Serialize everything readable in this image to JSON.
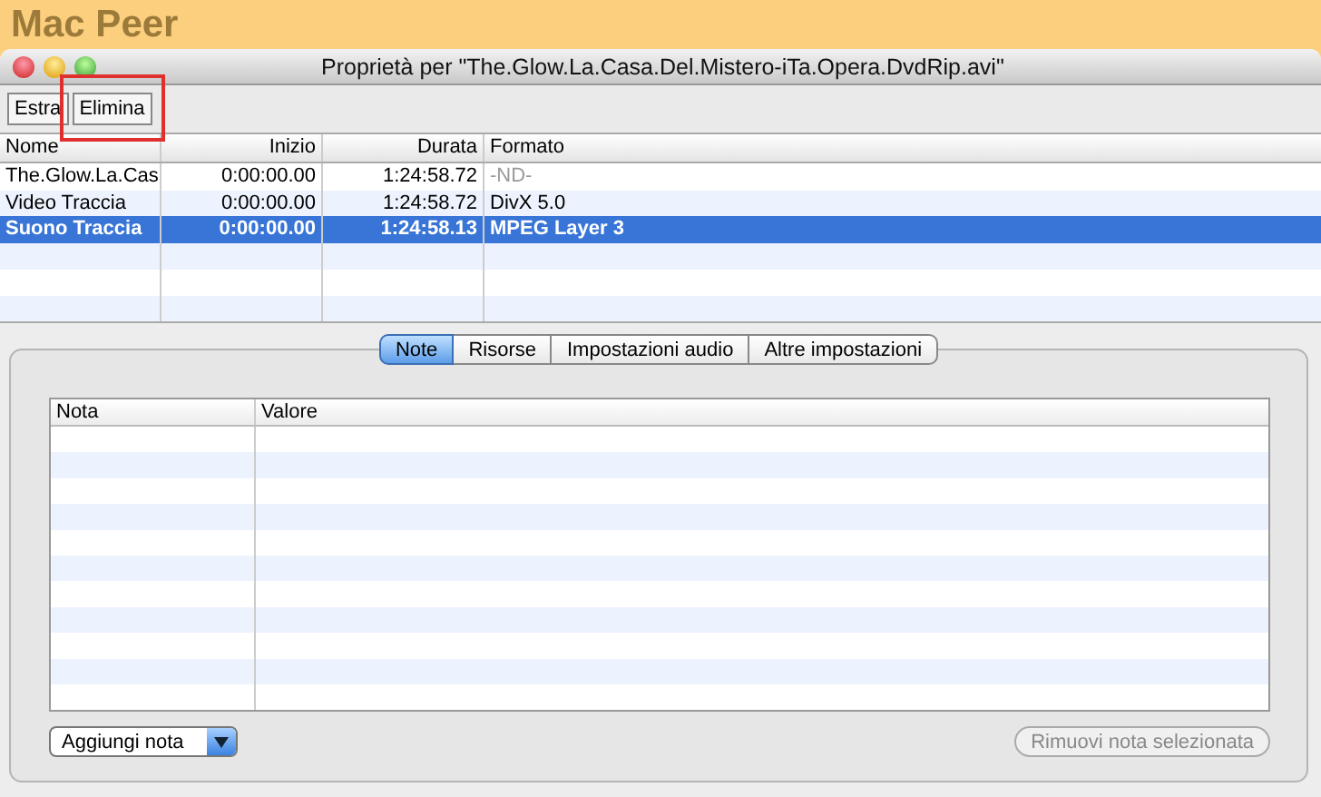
{
  "app_title": "Mac Peer",
  "window": {
    "title": "Proprietà per \"The.Glow.La.Casa.Del.Mistero-iTa.Opera.DvdRip.avi\""
  },
  "toolbar": {
    "buttons": [
      {
        "label": "Estra",
        "highlighted": false
      },
      {
        "label": "Elimina",
        "highlighted": true
      }
    ]
  },
  "tracks": {
    "columns": [
      "Nome",
      "Inizio",
      "Durata",
      "Formato"
    ],
    "rows": [
      {
        "name": "The.Glow.La.Cas",
        "start": "0:00:00.00",
        "duration": "1:24:58.72",
        "format": "-ND-",
        "format_dimmed": true,
        "selected": false
      },
      {
        "name": "Video Traccia",
        "start": "0:00:00.00",
        "duration": "1:24:58.72",
        "format": "DivX 5.0",
        "format_dimmed": false,
        "selected": false
      },
      {
        "name": "Suono Traccia",
        "start": "0:00:00.00",
        "duration": "1:24:58.13",
        "format": "MPEG Layer 3",
        "format_dimmed": false,
        "selected": true
      }
    ]
  },
  "tabs": [
    {
      "label": "Note",
      "selected": true
    },
    {
      "label": "Risorse",
      "selected": false
    },
    {
      "label": "Impostazioni audio",
      "selected": false
    },
    {
      "label": "Altre impostazioni",
      "selected": false
    }
  ],
  "notes": {
    "columns": [
      "Nota",
      "Valore"
    ]
  },
  "add_button": {
    "label": "Aggiungi nota"
  },
  "remove_button": {
    "label": "Rimuovi nota selezionata",
    "disabled": true
  }
}
